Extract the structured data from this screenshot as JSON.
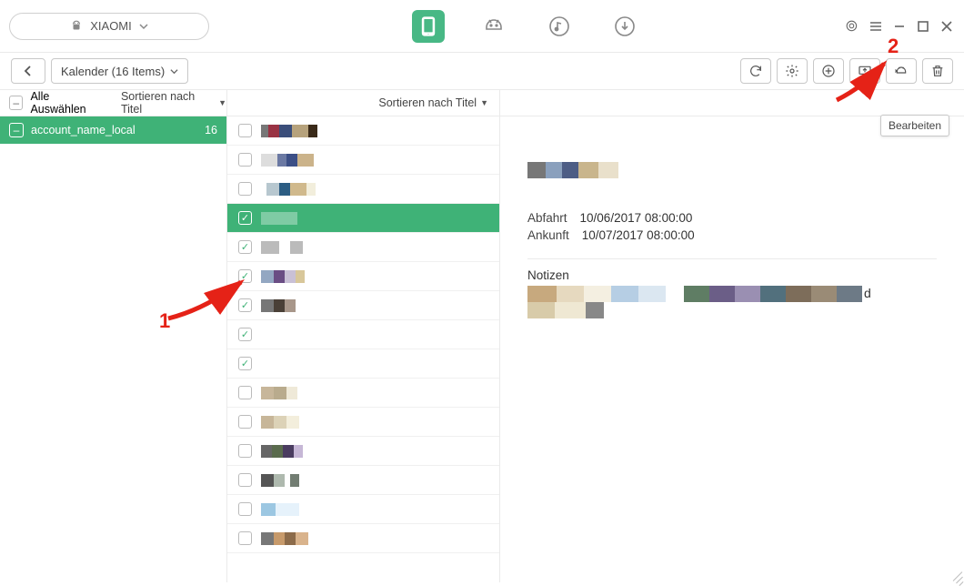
{
  "header": {
    "device_name": "XIAOMI"
  },
  "toolrow": {
    "breadcrumb": "Kalender (16 Items)"
  },
  "filter": {
    "select_all": "Alle Auswählen",
    "sort_left": "Sortieren nach Titel",
    "sort_mid": "Sortieren nach Titel"
  },
  "accounts": [
    {
      "name": "account_name_local",
      "count": "16"
    }
  ],
  "items": [
    {
      "checked": false,
      "selected": false,
      "blur": [
        [
          "#777",
          8
        ],
        [
          "#934",
          12
        ],
        [
          "#3b4e7a",
          14
        ],
        [
          "#b6a27c",
          18
        ],
        [
          "#3a2a19",
          10
        ]
      ]
    },
    {
      "checked": false,
      "selected": false,
      "blur": [
        [
          "#ddd",
          18
        ],
        [
          "#6b79a3",
          10
        ],
        [
          "#3c4f86",
          12
        ],
        [
          "#cbb38a",
          18
        ]
      ]
    },
    {
      "checked": false,
      "selected": false,
      "blur": [
        [
          "#fff0",
          6
        ],
        [
          "#b7c7cf",
          14
        ],
        [
          "#2c5d83",
          12
        ],
        [
          "#d0b98c",
          18
        ],
        [
          "#f2eedc",
          10
        ]
      ]
    },
    {
      "checked": true,
      "selected": true,
      "blur": [
        [
          "#ffffff55",
          40
        ]
      ]
    },
    {
      "checked": true,
      "selected": false,
      "blur": [
        [
          "#bbb",
          20
        ],
        [
          "#fff0",
          12
        ],
        [
          "#bbb",
          14
        ]
      ]
    },
    {
      "checked": true,
      "selected": false,
      "blur": [
        [
          "#93a7c2",
          14
        ],
        [
          "#6a4d84",
          12
        ],
        [
          "#c9c0d6",
          12
        ],
        [
          "#d8c79a",
          10
        ]
      ]
    },
    {
      "checked": true,
      "selected": false,
      "blur": [
        [
          "#777",
          14
        ],
        [
          "#4a4037",
          12
        ],
        [
          "#a8978a",
          12
        ]
      ]
    },
    {
      "checked": true,
      "selected": false,
      "blur": []
    },
    {
      "checked": true,
      "selected": false,
      "blur": [
        [
          "#fff0",
          2
        ]
      ]
    },
    {
      "checked": false,
      "selected": false,
      "blur": [
        [
          "#c7b69a",
          14
        ],
        [
          "#b9ab8d",
          14
        ],
        [
          "#efe9d8",
          12
        ]
      ]
    },
    {
      "checked": false,
      "selected": false,
      "blur": [
        [
          "#c7b699",
          14
        ],
        [
          "#dcd2b7",
          14
        ],
        [
          "#f3eedc",
          14
        ]
      ]
    },
    {
      "checked": false,
      "selected": false,
      "blur": [
        [
          "#666",
          12
        ],
        [
          "#5a6b4d",
          12
        ],
        [
          "#4a3c60",
          12
        ],
        [
          "#c6b7d6",
          10
        ]
      ]
    },
    {
      "checked": false,
      "selected": false,
      "blur": [
        [
          "#555",
          14
        ],
        [
          "#aeb9ae",
          12
        ],
        [
          "#fff0",
          6
        ],
        [
          "#727d72",
          10
        ]
      ]
    },
    {
      "checked": false,
      "selected": false,
      "blur": [
        [
          "#9cc7e2",
          16
        ],
        [
          "#e6f2fb",
          26
        ]
      ]
    },
    {
      "checked": false,
      "selected": false,
      "blur": [
        [
          "#777",
          14
        ],
        [
          "#c79a6b",
          12
        ],
        [
          "#8c6b4a",
          12
        ],
        [
          "#d9b38c",
          14
        ]
      ]
    }
  ],
  "detail": {
    "departure_label": "Abfahrt",
    "departure_value": "10/06/2017 08:00:00",
    "arrival_label": "Ankunft",
    "arrival_value": "10/07/2017 08:00:00",
    "notes_label": "Notizen",
    "trailing_char": "d"
  },
  "tooltip": "Bearbeiten",
  "callouts": {
    "one": "1",
    "two": "2"
  }
}
